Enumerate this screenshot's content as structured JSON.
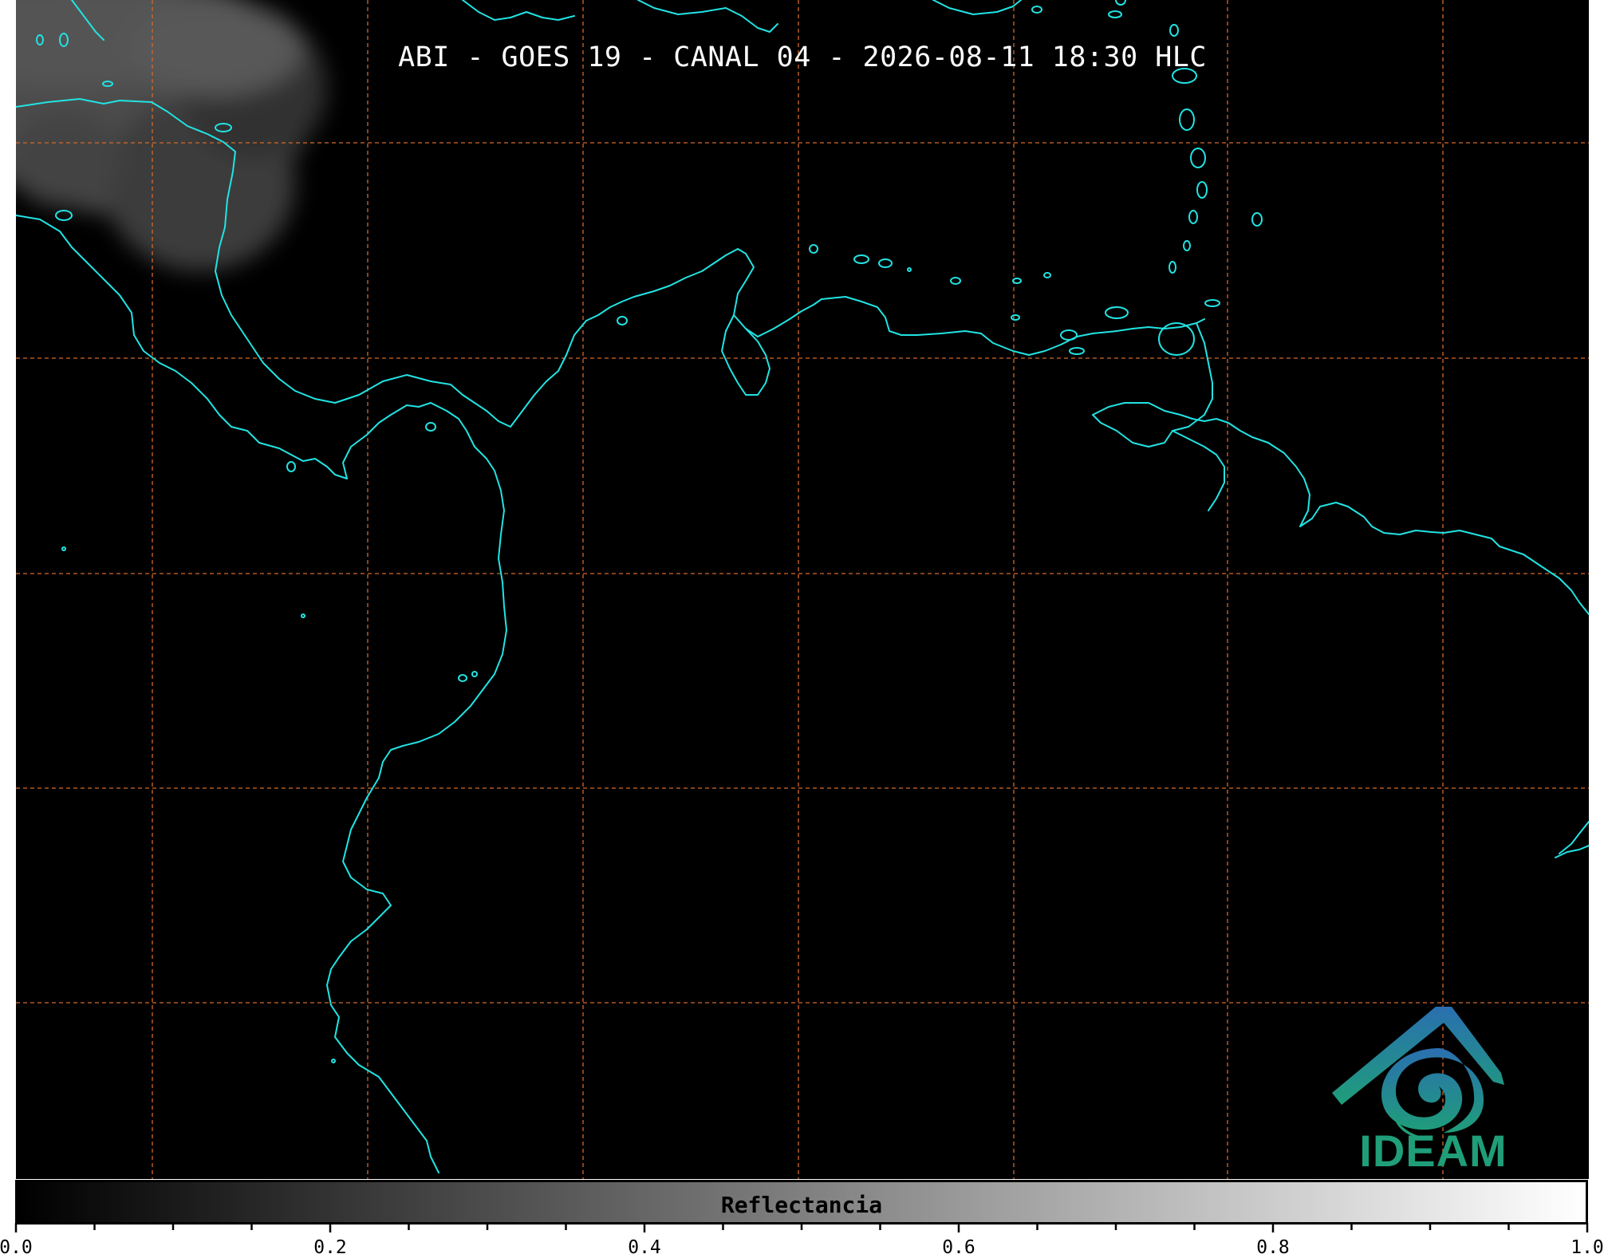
{
  "title": "ABI - GOES 19 - CANAL 04 - 2026-08-11 18:30 HLC",
  "map": {
    "background_color": "#000000",
    "coastline_color": "#22e3e3",
    "graticule_color": "#d3692a",
    "cloud_color": "#8a8a8a"
  },
  "logo": {
    "wordmark": "IDEAM",
    "emblem_icon": "ideam-mountain-spiral-icon",
    "color_top": "#2a6fb0",
    "color_bottom": "#1f9e79"
  },
  "colorbar": {
    "label": "Reflectancia",
    "min": 0.0,
    "max": 1.0,
    "colormap": "grayscale",
    "ticks": [
      "0.0",
      "0.2",
      "0.4",
      "0.6",
      "0.8",
      "1.0"
    ]
  }
}
